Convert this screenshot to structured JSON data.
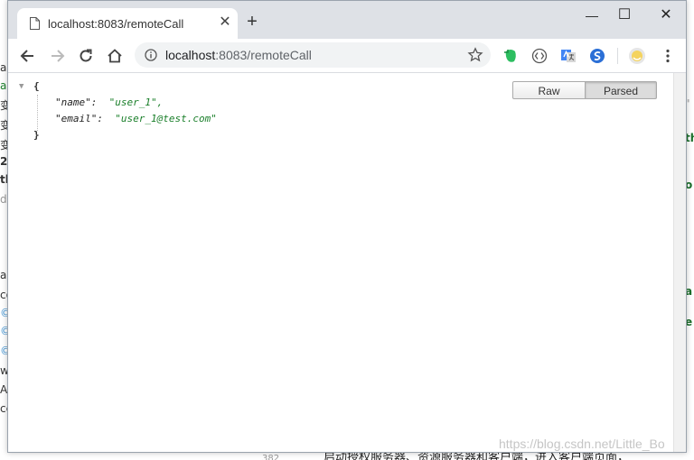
{
  "background_fragments": {
    "left": [
      "a",
      "a",
      "变",
      "变",
      "变",
      "2",
      "th",
      "de",
      "a.f",
      "co",
      "©",
      "©",
      "©",
      "w",
      "Ad",
      "ce"
    ],
    "right": [
      "\"",
      "th",
      "o",
      "a",
      "e"
    ],
    "bottom_line_number": "382",
    "bottom_text": "启动授权服务器、资源服务器和客户端，进入客户端页面，"
  },
  "browser": {
    "tab_title": "localhost:8083/remoteCall",
    "tab_close": "✕",
    "new_tab": "+",
    "window_controls": {
      "minimize": "—",
      "maximize": "☐",
      "close": "✕"
    },
    "address": {
      "host": "localhost",
      "path": ":8083/remoteCall"
    }
  },
  "json_viewer": {
    "open_brace": "{",
    "close_brace": "}",
    "entries": [
      {
        "key": "\"name\":",
        "value": "\"user_1\","
      },
      {
        "key": "\"email\":",
        "value": "\"user_1@test.com\""
      }
    ],
    "raw_label": "Raw",
    "parsed_label": "Parsed"
  },
  "watermark": "https://blog.csdn.net/Little_Bo"
}
